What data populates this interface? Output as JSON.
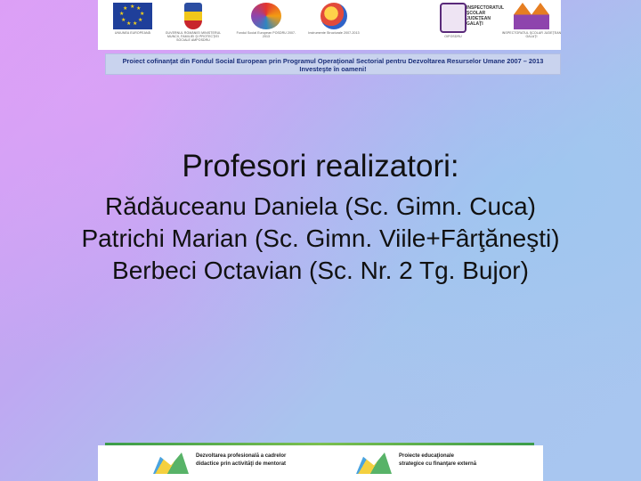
{
  "header": {
    "logos": [
      {
        "icon": "eu-flag-icon",
        "caption": "UNIUNEA EUROPEANĂ"
      },
      {
        "icon": "romania-coat-of-arms-icon",
        "caption": "GUVERNUL ROMÂNIEI MINISTERUL MUNCII, FAMILIEI ŞI PROTECŢIEI SOCIALE AMPOSDRU"
      },
      {
        "icon": "fse-logo-icon",
        "caption": "Fondul Social European POSDRU 2007-2013"
      },
      {
        "icon": "instrumente-structurale-icon",
        "caption": "Instrumente Structurale 2007-2013"
      },
      {
        "icon": "university-seal-icon",
        "caption": "OIPOSDRU"
      },
      {
        "icon": "houses-logo-icon",
        "caption": "INSPECTORATUL ŞCOLAR JUDEŢEAN GALAŢI"
      }
    ],
    "inspectorate_text": "INSPECTORATUL ŞCOLAR JUDEŢEAN GALAŢI",
    "banner_line1": "Proiect cofinanţat din Fondul Social European prin Programul Operaţional Sectorial pentru Dezvoltarea Resurselor Umane 2007 – 2013",
    "banner_line2": "Investeşte în oameni!"
  },
  "main": {
    "title": "Profesori realizatori:",
    "authors": [
      "Rădăuceanu Daniela (Sc. Gimn. Cuca)",
      "Patrichi Marian (Sc. Gimn. Viile+Fârţăneşti)",
      "Berbeci Octavian (Sc. Nr. 2 Tg. Bujor)"
    ]
  },
  "footer": {
    "project_left_line1": "Dezvoltarea profesională a cadrelor",
    "project_left_line2": "didactice prin activităţi de mentorat",
    "project_right_line1": "Proiecte educaţionale",
    "project_right_line2": "strategice cu finanţare externă"
  },
  "colors": {
    "text": "#111111",
    "banner_text": "#1b2f7a",
    "accent_line": "#3b9c4a"
  }
}
